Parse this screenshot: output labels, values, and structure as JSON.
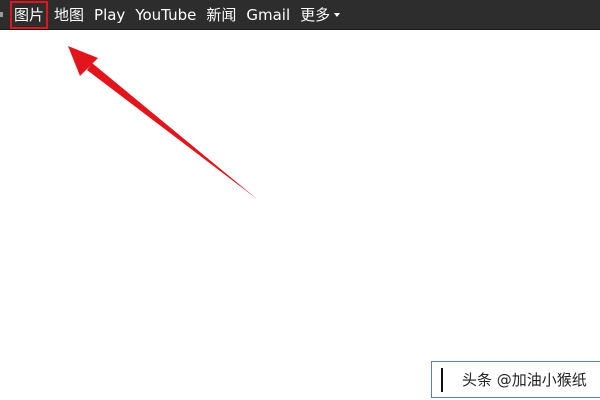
{
  "topbar": {
    "nav_items": [
      {
        "label": "图片",
        "highlighted": true
      },
      {
        "label": "地图"
      },
      {
        "label": "Play"
      },
      {
        "label": "YouTube"
      },
      {
        "label": "新闻"
      },
      {
        "label": "Gmail"
      },
      {
        "label": "更多"
      }
    ],
    "more_icon": "chevron-down-icon"
  },
  "annotation": {
    "arrow_color": "#e0161c",
    "highlight_color": "#e0161c"
  },
  "watermark": {
    "text": "头条 @加油小猴纸"
  }
}
